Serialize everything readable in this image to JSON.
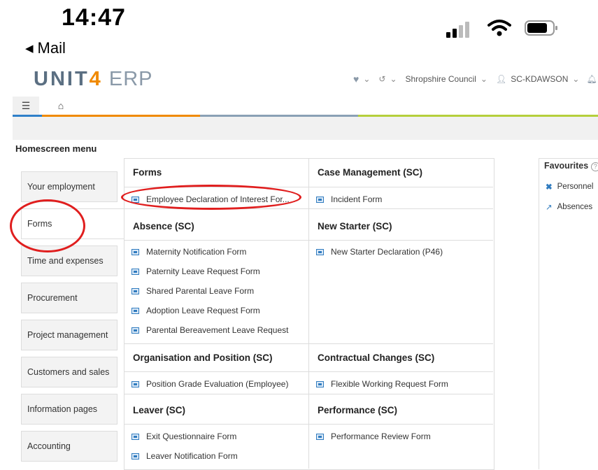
{
  "status_bar": {
    "time": "14:47",
    "back_label": "Mail"
  },
  "header": {
    "logo_unit": "UNIT",
    "logo_four": "4",
    "logo_erp": " ERP",
    "company": "Shropshire Council",
    "user": "SC-KDAWSON"
  },
  "homescreen_title": "Homescreen menu",
  "left_menu": [
    "Your employment",
    "Forms",
    "Time and expenses",
    "Procurement",
    "Project management",
    "Customers and sales",
    "Information pages",
    "Accounting"
  ],
  "sections": {
    "forms": {
      "title": "Forms",
      "items": [
        "Employee Declaration of Interest For..."
      ]
    },
    "case_management": {
      "title": "Case Management (SC)",
      "items": [
        "Incident Form"
      ]
    },
    "absence": {
      "title": "Absence (SC)",
      "items": [
        "Maternity Notification Form",
        "Paternity Leave Request Form",
        "Shared Parental Leave Form",
        "Adoption Leave Request Form",
        "Parental Bereavement Leave Request"
      ]
    },
    "new_starter": {
      "title": "New Starter (SC)",
      "items": [
        "New Starter Declaration (P46)"
      ]
    },
    "organisation": {
      "title": "Organisation and Position (SC)",
      "items": [
        "Position Grade Evaluation (Employee)"
      ]
    },
    "contractual": {
      "title": "Contractual Changes (SC)",
      "items": [
        "Flexible Working Request Form"
      ]
    },
    "leaver": {
      "title": "Leaver (SC)",
      "items": [
        "Exit Questionnaire Form",
        "Leaver Notification Form"
      ]
    },
    "performance": {
      "title": "Performance (SC)",
      "items": [
        "Performance Review Form"
      ]
    }
  },
  "favourites": {
    "title": "Favourites",
    "items": [
      "Personnel",
      "Absences"
    ]
  },
  "colors": {
    "accent_blue": "#2f7bbf",
    "accent_orange": "#f08a00",
    "annotation_red": "#e01e1e"
  }
}
